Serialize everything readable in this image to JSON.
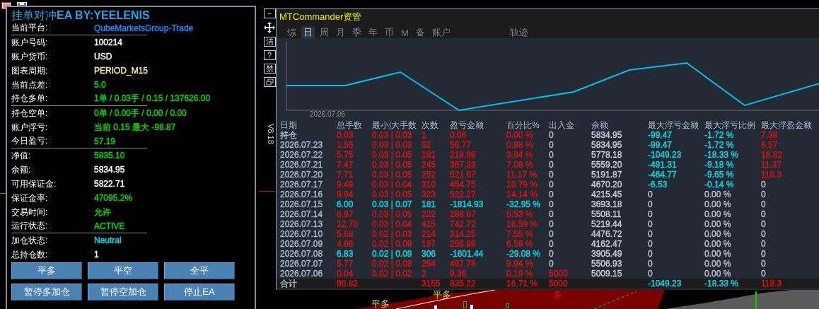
{
  "panel": {
    "title": "挂单对冲**EA BY:YEELENIS**",
    "rows": [
      {
        "label": "当前平台:",
        "value": "QubeMarketsGroup-Trade",
        "color": "#1a8cff",
        "underlined": true
      },
      {
        "label": "账户号码:",
        "value": "100214",
        "color": "#ffffff",
        "underlined": false
      },
      {
        "label": "账户货币:",
        "value": "USD",
        "color": "#ffffff",
        "underlined": false
      },
      {
        "label": "图表周期:",
        "value": "PERIOD_M15",
        "color": "#f5e6a8",
        "underlined": false
      },
      {
        "label": "当前点差:",
        "value": "5.0",
        "color": "#00dd00",
        "underlined": false
      },
      {
        "label": "持仓多单:",
        "value": "1单 / 0.03手 / 0.15 / 137626.00",
        "color": "#00dd00",
        "underlined": true
      },
      {
        "label": "持仓空单:",
        "value": "0单 / 0.00手 / 0.00 / 0.00",
        "color": "#00dd00",
        "underlined": false
      },
      {
        "label": "账户浮亏:",
        "value": "当前 0.15  最大 -98.87",
        "color": "#00dd00",
        "underlined": false
      },
      {
        "label": "今日盈亏:",
        "value": "57.19",
        "color": "#00dd00",
        "underlined": true
      },
      {
        "label": "净值:",
        "value": "5835.10",
        "color": "#00dd00",
        "underlined": false
      },
      {
        "label": "余额:",
        "value": "5834.95",
        "color": "#ffffff",
        "underlined": false
      },
      {
        "label": "可用保证金:",
        "value": "5822.71",
        "color": "#ffffff",
        "underlined": false
      },
      {
        "label": "保证金率:",
        "value": "47095.2%",
        "color": "#00dd00",
        "underlined": false
      },
      {
        "label": "交易时间:",
        "value": "允许",
        "color": "#00dd00",
        "underlined": false
      },
      {
        "label": "运行状态:",
        "value": "ACTIVE",
        "color": "#00dd00",
        "underlined": true
      },
      {
        "label": "加仓状态:",
        "value": "Neutral",
        "color": "#00e0f0",
        "underlined": false
      },
      {
        "label": "总持仓数:",
        "value": "1",
        "color": "#ffffff",
        "underlined": false
      }
    ],
    "buttons": [
      "平多",
      "平空",
      "全平",
      "暂停多加仓",
      "暂停空加仓",
      "停止EA"
    ]
  },
  "toolbar": [
    {
      "kind": "text",
      "label": "−"
    },
    {
      "kind": "move"
    },
    {
      "kind": "text",
      "label": "清"
    },
    {
      "kind": "text",
      "label": "?"
    },
    {
      "kind": "text",
      "label": "禁"
    },
    {
      "kind": "restore"
    }
  ],
  "version": "V8.18",
  "commander": {
    "title": "MTCommander资管",
    "tabs": [
      {
        "label": "综",
        "selected": false
      },
      {
        "label": "日",
        "selected": true
      },
      {
        "label": "周",
        "selected": false
      },
      {
        "label": "月",
        "selected": false
      },
      {
        "label": "季",
        "selected": false
      },
      {
        "label": "年",
        "selected": false
      },
      {
        "label": "币",
        "selected": false
      },
      {
        "label": "M",
        "selected": false
      },
      {
        "label": "备",
        "selected": false
      },
      {
        "label": "账户",
        "selected": false
      }
    ],
    "extra_tabs": [
      {
        "label": "轨迹",
        "selected": false
      }
    ],
    "equity_date": "2026.07.06",
    "columns": [
      "日期",
      "总手数",
      "最小|大手数",
      "次数",
      "盈亏金额",
      "百分比%",
      "出入金",
      "余额",
      "最大浮亏金额",
      "最大浮亏比例",
      "最大浮盈金额"
    ],
    "rows": [
      {
        "cells": [
          {
            "text": "持仓",
            "color": "#aab8cc"
          },
          {
            "text": "0.03",
            "color": "#e01010"
          },
          {
            "text": "0.03 | 0.03",
            "color": "#e01010"
          },
          {
            "text": "1",
            "color": "#e01010"
          },
          {
            "text": "0.06",
            "color": "#e01010"
          },
          {
            "text": "0.00 %",
            "color": "#e01010"
          },
          {
            "text": "0",
            "color": "#b8c0cc"
          },
          {
            "text": "5834.95",
            "color": "#c4ccd6"
          },
          {
            "text": "-99.47",
            "color": "#10d8e8"
          },
          {
            "text": "-1.72 %",
            "color": "#10d8e8"
          },
          {
            "text": "7.38",
            "color": "#e01010"
          }
        ]
      },
      {
        "cells": [
          {
            "text": "2026.07.23",
            "color": "#aab8cc"
          },
          {
            "text": "1.56",
            "color": "#e01010"
          },
          {
            "text": "0.03 | 0.03",
            "color": "#e01010"
          },
          {
            "text": "52",
            "color": "#e01010"
          },
          {
            "text": "56.77",
            "color": "#e01010"
          },
          {
            "text": "0.98 %",
            "color": "#e01010"
          },
          {
            "text": "0",
            "color": "#b8c0cc"
          },
          {
            "text": "5834.95",
            "color": "#c4ccd6"
          },
          {
            "text": "-99.47",
            "color": "#10d8e8"
          },
          {
            "text": "-1.72 %",
            "color": "#10d8e8"
          },
          {
            "text": "6.57",
            "color": "#e01010"
          }
        ]
      },
      {
        "cells": [
          {
            "text": "2026.07.22",
            "color": "#aab8cc"
          },
          {
            "text": "5.75",
            "color": "#e01010"
          },
          {
            "text": "0.03 | 0.05",
            "color": "#e01010"
          },
          {
            "text": "181",
            "color": "#e01010"
          },
          {
            "text": "218.98",
            "color": "#e01010"
          },
          {
            "text": "3.94 %",
            "color": "#e01010"
          },
          {
            "text": "0",
            "color": "#b8c0cc"
          },
          {
            "text": "5778.18",
            "color": "#c4ccd6"
          },
          {
            "text": "-1049.23",
            "color": "#10d8e8"
          },
          {
            "text": "-18.33 %",
            "color": "#10d8e8"
          },
          {
            "text": "16.82",
            "color": "#e01010"
          }
        ]
      },
      {
        "cells": [
          {
            "text": "2026.07.21",
            "color": "#aab8cc"
          },
          {
            "text": "7.47",
            "color": "#e01010"
          },
          {
            "text": "0.03 | 0.05",
            "color": "#e01010"
          },
          {
            "text": "245",
            "color": "#e01010"
          },
          {
            "text": "367.33",
            "color": "#e01010"
          },
          {
            "text": "7.08 %",
            "color": "#e01010"
          },
          {
            "text": "0",
            "color": "#b8c0cc"
          },
          {
            "text": "5559.20",
            "color": "#c4ccd6"
          },
          {
            "text": "-491.31",
            "color": "#10d8e8"
          },
          {
            "text": "-9.18 %",
            "color": "#10d8e8"
          },
          {
            "text": "11.37",
            "color": "#e01010"
          }
        ]
      },
      {
        "cells": [
          {
            "text": "2026.07.20",
            "color": "#aab8cc"
          },
          {
            "text": "7.71",
            "color": "#e01010"
          },
          {
            "text": "0.03 | 0.05",
            "color": "#e01010"
          },
          {
            "text": "252",
            "color": "#e01010"
          },
          {
            "text": "521.67",
            "color": "#e01010"
          },
          {
            "text": "11.17 %",
            "color": "#e01010"
          },
          {
            "text": "0",
            "color": "#b8c0cc"
          },
          {
            "text": "5191.87",
            "color": "#c4ccd6"
          },
          {
            "text": "-464.77",
            "color": "#10d8e8"
          },
          {
            "text": "-9.65 %",
            "color": "#10d8e8"
          },
          {
            "text": "118.3",
            "color": "#e01010"
          }
        ]
      },
      {
        "cells": [
          {
            "text": "2026.07.17",
            "color": "#aab8cc"
          },
          {
            "text": "9.49",
            "color": "#e01010"
          },
          {
            "text": "0.03 | 0.04",
            "color": "#e01010"
          },
          {
            "text": "310",
            "color": "#e01010"
          },
          {
            "text": "454.75",
            "color": "#e01010"
          },
          {
            "text": "10.79 %",
            "color": "#e01010"
          },
          {
            "text": "0",
            "color": "#b8c0cc"
          },
          {
            "text": "4670.20",
            "color": "#c4ccd6"
          },
          {
            "text": "-6.53",
            "color": "#10d8e8"
          },
          {
            "text": "-0.14 %",
            "color": "#10d8e8"
          },
          {
            "text": "0",
            "color": "#b8c0cc"
          }
        ]
      },
      {
        "cells": [
          {
            "text": "2026.07.16",
            "color": "#aab8cc"
          },
          {
            "text": "9.94",
            "color": "#e01010"
          },
          {
            "text": "0.03 | 0.05",
            "color": "#e01010"
          },
          {
            "text": "323",
            "color": "#e01010"
          },
          {
            "text": "522.27",
            "color": "#e01010"
          },
          {
            "text": "14.14 %",
            "color": "#e01010"
          },
          {
            "text": "0",
            "color": "#b8c0cc"
          },
          {
            "text": "4215.45",
            "color": "#c4ccd6"
          },
          {
            "text": "0",
            "color": "#b8c0cc"
          },
          {
            "text": "0.00 %",
            "color": "#b8c0cc"
          },
          {
            "text": "0",
            "color": "#b8c0cc"
          }
        ]
      },
      {
        "cells": [
          {
            "text": "2026.07.15",
            "color": "#aab8cc"
          },
          {
            "text": "6.00",
            "color": "#10d8e8"
          },
          {
            "text": "0.03 | 0.07",
            "color": "#10d8e8"
          },
          {
            "text": "181",
            "color": "#10d8e8"
          },
          {
            "text": "-1814.93",
            "color": "#10d8e8"
          },
          {
            "text": "-32.95 %",
            "color": "#10d8e8"
          },
          {
            "text": "0",
            "color": "#b8c0cc"
          },
          {
            "text": "3693.18",
            "color": "#c4ccd6"
          },
          {
            "text": "0",
            "color": "#b8c0cc"
          },
          {
            "text": "0.00 %",
            "color": "#b8c0cc"
          },
          {
            "text": "0",
            "color": "#b8c0cc"
          }
        ]
      },
      {
        "cells": [
          {
            "text": "2026.07.14",
            "color": "#aab8cc"
          },
          {
            "text": "6.97",
            "color": "#e01010"
          },
          {
            "text": "0.03 | 0.05",
            "color": "#e01010"
          },
          {
            "text": "222",
            "color": "#e01010"
          },
          {
            "text": "288.67",
            "color": "#e01010"
          },
          {
            "text": "5.53 %",
            "color": "#e01010"
          },
          {
            "text": "0",
            "color": "#b8c0cc"
          },
          {
            "text": "5508.11",
            "color": "#c4ccd6"
          },
          {
            "text": "0",
            "color": "#b8c0cc"
          },
          {
            "text": "0.00 %",
            "color": "#b8c0cc"
          },
          {
            "text": "0",
            "color": "#b8c0cc"
          }
        ]
      },
      {
        "cells": [
          {
            "text": "2026.07.13",
            "color": "#aab8cc"
          },
          {
            "text": "12.70",
            "color": "#e01010"
          },
          {
            "text": "0.03 | 0.04",
            "color": "#e01010"
          },
          {
            "text": "415",
            "color": "#e01010"
          },
          {
            "text": "742.72",
            "color": "#e01010"
          },
          {
            "text": "16.59 %",
            "color": "#e01010"
          },
          {
            "text": "0",
            "color": "#b8c0cc"
          },
          {
            "text": "5219.44",
            "color": "#c4ccd6"
          },
          {
            "text": "0",
            "color": "#b8c0cc"
          },
          {
            "text": "0.00 %",
            "color": "#b8c0cc"
          },
          {
            "text": "0",
            "color": "#b8c0cc"
          }
        ]
      },
      {
        "cells": [
          {
            "text": "2026.07.10",
            "color": "#aab8cc"
          },
          {
            "text": "5.68",
            "color": "#e01010"
          },
          {
            "text": "0.02 | 0.03",
            "color": "#e01010"
          },
          {
            "text": "214",
            "color": "#e01010"
          },
          {
            "text": "314.25",
            "color": "#e01010"
          },
          {
            "text": "7.55 %",
            "color": "#e01010"
          },
          {
            "text": "0",
            "color": "#b8c0cc"
          },
          {
            "text": "4476.72",
            "color": "#c4ccd6"
          },
          {
            "text": "0",
            "color": "#b8c0cc"
          },
          {
            "text": "0.00 %",
            "color": "#b8c0cc"
          },
          {
            "text": "0",
            "color": "#b8c0cc"
          }
        ]
      },
      {
        "cells": [
          {
            "text": "2026.07.09",
            "color": "#aab8cc"
          },
          {
            "text": "4.88",
            "color": "#e01010"
          },
          {
            "text": "0.02 | 0.09",
            "color": "#e01010"
          },
          {
            "text": "197",
            "color": "#e01010"
          },
          {
            "text": "256.98",
            "color": "#e01010"
          },
          {
            "text": "6.58 %",
            "color": "#e01010"
          },
          {
            "text": "0",
            "color": "#b8c0cc"
          },
          {
            "text": "4162.47",
            "color": "#c4ccd6"
          },
          {
            "text": "0",
            "color": "#b8c0cc"
          },
          {
            "text": "0.00 %",
            "color": "#b8c0cc"
          },
          {
            "text": "0",
            "color": "#b8c0cc"
          }
        ]
      },
      {
        "cells": [
          {
            "text": "2026.07.08",
            "color": "#aab8cc"
          },
          {
            "text": "6.83",
            "color": "#10d8e8"
          },
          {
            "text": "0.02 | 0.09",
            "color": "#10d8e8"
          },
          {
            "text": "306",
            "color": "#10d8e8"
          },
          {
            "text": "-1601.44",
            "color": "#10d8e8"
          },
          {
            "text": "-29.08 %",
            "color": "#10d8e8"
          },
          {
            "text": "0",
            "color": "#b8c0cc"
          },
          {
            "text": "3905.49",
            "color": "#c4ccd6"
          },
          {
            "text": "0",
            "color": "#b8c0cc"
          },
          {
            "text": "0.00 %",
            "color": "#b8c0cc"
          },
          {
            "text": "0",
            "color": "#b8c0cc"
          }
        ]
      },
      {
        "cells": [
          {
            "text": "2026.07.07",
            "color": "#aab8cc"
          },
          {
            "text": "5.77",
            "color": "#e01010"
          },
          {
            "text": "0.02 | 0.08",
            "color": "#e01010"
          },
          {
            "text": "254",
            "color": "#e01010"
          },
          {
            "text": "497.78",
            "color": "#e01010"
          },
          {
            "text": "9.94 %",
            "color": "#e01010"
          },
          {
            "text": "0",
            "color": "#b8c0cc"
          },
          {
            "text": "5506.93",
            "color": "#c4ccd6"
          },
          {
            "text": "0",
            "color": "#b8c0cc"
          },
          {
            "text": "0.00 %",
            "color": "#b8c0cc"
          },
          {
            "text": "0",
            "color": "#b8c0cc"
          }
        ]
      },
      {
        "cells": [
          {
            "text": "2026.07.06",
            "color": "#aab8cc"
          },
          {
            "text": "0.04",
            "color": "#e01010"
          },
          {
            "text": "0.02 | 0.02",
            "color": "#e01010"
          },
          {
            "text": "2",
            "color": "#e01010"
          },
          {
            "text": "9.36",
            "color": "#e01010"
          },
          {
            "text": "0.19 %",
            "color": "#e01010"
          },
          {
            "text": "5000",
            "color": "#e01010"
          },
          {
            "text": "5009.15",
            "color": "#c4ccd6"
          },
          {
            "text": "0",
            "color": "#b8c0cc"
          },
          {
            "text": "0.00 %",
            "color": "#b8c0cc"
          },
          {
            "text": "0",
            "color": "#b8c0cc"
          }
        ]
      }
    ],
    "total": {
      "cells": [
        {
          "text": "合计",
          "color": "#aab8cc"
        },
        {
          "text": "90.82",
          "color": "#e01010"
        },
        null,
        {
          "text": "3155",
          "color": "#e01010"
        },
        {
          "text": "835.22",
          "color": "#e01010"
        },
        {
          "text": "16.71 %",
          "color": "#e01010"
        },
        {
          "text": "5000",
          "color": "#e01010"
        },
        null,
        {
          "text": "-1049.23",
          "color": "#10d8e8"
        },
        {
          "text": "-18.33 %",
          "color": "#10d8e8"
        },
        {
          "text": "118.3",
          "color": "#e01010"
        }
      ]
    }
  },
  "chart_labels": [
    {
      "text": "平多",
      "color": "#e8e000"
    },
    {
      "text": "平多",
      "color": "#e8e000"
    },
    {
      "text": "多",
      "color": "#e01010"
    }
  ]
}
